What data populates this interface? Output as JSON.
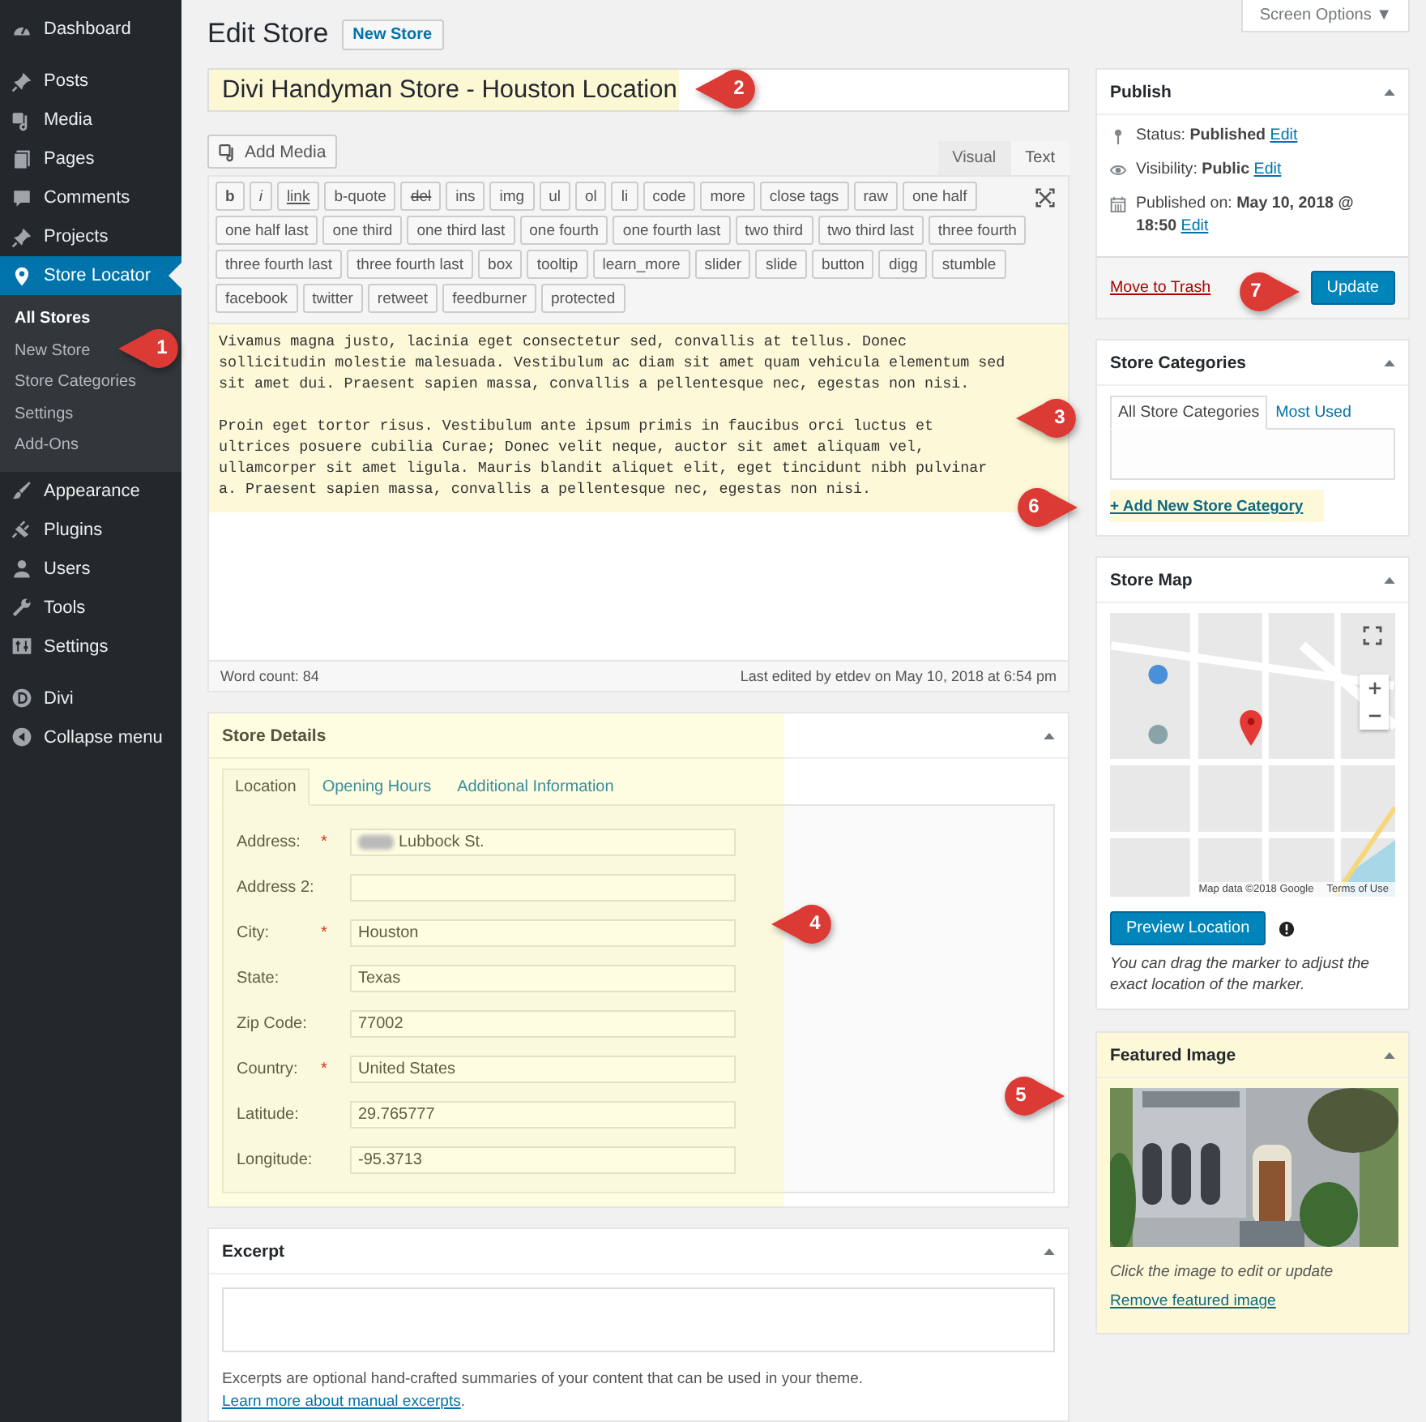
{
  "sidebar": {
    "groups": [
      [
        {
          "label": "Dashboard",
          "selected": false
        }
      ],
      [
        {
          "label": "Posts",
          "selected": false
        },
        {
          "label": "Media",
          "selected": false
        },
        {
          "label": "Pages",
          "selected": false
        },
        {
          "label": "Comments",
          "selected": false
        },
        {
          "label": "Projects",
          "selected": false
        },
        {
          "label": "Store Locator",
          "selected": true,
          "children": [
            {
              "label": "All Stores",
              "selected": true
            },
            {
              "label": "New Store",
              "selected": false
            },
            {
              "label": "Store Categories",
              "selected": false
            },
            {
              "label": "Settings",
              "selected": false
            },
            {
              "label": "Add-Ons",
              "selected": false
            }
          ]
        },
        {
          "label": "Appearance",
          "selected": false
        },
        {
          "label": "Plugins",
          "selected": false
        },
        {
          "label": "Users",
          "selected": false
        },
        {
          "label": "Tools",
          "selected": false
        },
        {
          "label": "Settings",
          "selected": false
        }
      ],
      [
        {
          "label": "Divi",
          "selected": false
        },
        {
          "label": "Collapse menu",
          "selected": false
        }
      ]
    ]
  },
  "header": {
    "title": "Edit Store",
    "new_button": "New Store",
    "screen_options": "Screen Options ▼"
  },
  "post_title": "Divi Handyman Store - Houston Location",
  "editor": {
    "add_media": "Add Media",
    "tabs": [
      {
        "label": "Visual",
        "selected": false
      },
      {
        "label": "Text",
        "selected": true
      }
    ],
    "toolbar_rows": [
      [
        {
          "label": "b",
          "kind": "bold"
        },
        {
          "label": "i",
          "kind": "italic"
        },
        {
          "label": "link",
          "kind": "link"
        },
        {
          "label": "b-quote",
          "kind": "plain"
        },
        {
          "label": "del",
          "kind": "del"
        },
        {
          "label": "ins",
          "kind": "plain"
        },
        {
          "label": "img",
          "kind": "plain"
        },
        {
          "label": "ul",
          "kind": "plain"
        },
        {
          "label": "ol",
          "kind": "plain"
        },
        {
          "label": "li",
          "kind": "plain"
        },
        {
          "label": "code",
          "kind": "plain"
        },
        {
          "label": "more",
          "kind": "plain"
        },
        {
          "label": "close tags",
          "kind": "plain"
        },
        {
          "label": "raw",
          "kind": "plain"
        },
        {
          "label": "one half",
          "kind": "plain"
        }
      ],
      [
        {
          "label": "one half last",
          "kind": "plain"
        },
        {
          "label": "one third",
          "kind": "plain"
        },
        {
          "label": "one third last",
          "kind": "plain"
        },
        {
          "label": "one fourth",
          "kind": "plain"
        },
        {
          "label": "one fourth last",
          "kind": "plain"
        },
        {
          "label": "two third",
          "kind": "plain"
        },
        {
          "label": "two third last",
          "kind": "plain"
        },
        {
          "label": "three fourth",
          "kind": "plain"
        }
      ],
      [
        {
          "label": "three fourth last",
          "kind": "plain"
        },
        {
          "label": "three fourth last",
          "kind": "plain"
        },
        {
          "label": "box",
          "kind": "plain"
        },
        {
          "label": "tooltip",
          "kind": "plain"
        },
        {
          "label": "learn_more",
          "kind": "plain"
        },
        {
          "label": "slider",
          "kind": "plain"
        },
        {
          "label": "slide",
          "kind": "plain"
        },
        {
          "label": "button",
          "kind": "plain"
        },
        {
          "label": "digg",
          "kind": "plain"
        },
        {
          "label": "stumble",
          "kind": "plain"
        }
      ],
      [
        {
          "label": "facebook",
          "kind": "plain"
        },
        {
          "label": "twitter",
          "kind": "plain"
        },
        {
          "label": "retweet",
          "kind": "plain"
        },
        {
          "label": "feedburner",
          "kind": "plain"
        },
        {
          "label": "protected",
          "kind": "plain"
        }
      ]
    ],
    "paragraphs": [
      "Vivamus magna justo, lacinia eget consectetur sed, convallis at tellus. Donec sollicitudin molestie malesuada. Vestibulum ac diam sit amet quam vehicula elementum sed sit amet dui. Praesent sapien massa, convallis a pellentesque nec, egestas non nisi.",
      "Proin eget tortor risus. Vestibulum ante ipsum primis in faucibus orci luctus et ultrices posuere cubilia Curae; Donec velit neque, auctor sit amet aliquam vel, ullamcorper sit amet ligula. Mauris blandit aliquet elit, eget tincidunt nibh pulvinar a. Praesent sapien massa, convallis a pellentesque nec, egestas non nisi."
    ],
    "word_count": "Word count: 84",
    "last_edited": "Last edited by etdev on May 10, 2018 at 6:54 pm"
  },
  "store_details": {
    "title": "Store Details",
    "required_marker": "*",
    "tabs": [
      {
        "label": "Location",
        "selected": true
      },
      {
        "label": "Opening Hours",
        "selected": false
      },
      {
        "label": "Additional Information",
        "selected": false
      }
    ],
    "fields": [
      {
        "label": "Address:",
        "required": true,
        "value": "Lubbock St.",
        "redacted": true
      },
      {
        "label": "Address 2:",
        "required": false,
        "redacted": false
      },
      {
        "label": "City:",
        "required": true,
        "value": "Houston",
        "redacted": false
      },
      {
        "label": "State:",
        "required": false,
        "value": "Texas",
        "redacted": false
      },
      {
        "label": "Zip Code:",
        "required": false,
        "value": "77002",
        "redacted": false
      },
      {
        "label": "Country:",
        "required": true,
        "value": "United States",
        "redacted": false
      },
      {
        "label": "Latitude:",
        "required": false,
        "value": "29.765777",
        "redacted": false
      },
      {
        "label": "Longitude:",
        "required": false,
        "value": "-95.3713",
        "redacted": false
      }
    ]
  },
  "excerpt": {
    "title": "Excerpt",
    "help": "Excerpts are optional hand-crafted summaries of your content that can be used in your theme.",
    "help_link": "Learn more about manual excerpts",
    "help_end": "."
  },
  "publish": {
    "title": "Publish",
    "rows": [
      {
        "label": "Status:",
        "value": "Published",
        "link": "Edit"
      },
      {
        "label": "Visibility:",
        "value": "Public",
        "link": "Edit"
      },
      {
        "label": "Published on:",
        "value": "May 10, 2018 @ 18:50",
        "link": "Edit"
      }
    ],
    "trash": "Move to Trash",
    "update": "Update"
  },
  "store_categories": {
    "title": "Store Categories",
    "tabs": [
      {
        "label": "All Store Categories",
        "selected": true
      },
      {
        "label": "Most Used",
        "selected": false
      }
    ],
    "add_link": "+ Add New Store Category"
  },
  "store_map": {
    "title": "Store Map",
    "map_data": "Map data ©2018 Google",
    "terms": "Terms of Use",
    "preview": "Preview Location",
    "hint": "You can drag the marker to adjust the exact location of the marker."
  },
  "featured_image": {
    "title": "Featured Image",
    "caption": "Click the image to edit or update",
    "remove": "Remove featured image"
  },
  "callouts": [
    "1",
    "2",
    "3",
    "4",
    "5",
    "6",
    "7"
  ]
}
